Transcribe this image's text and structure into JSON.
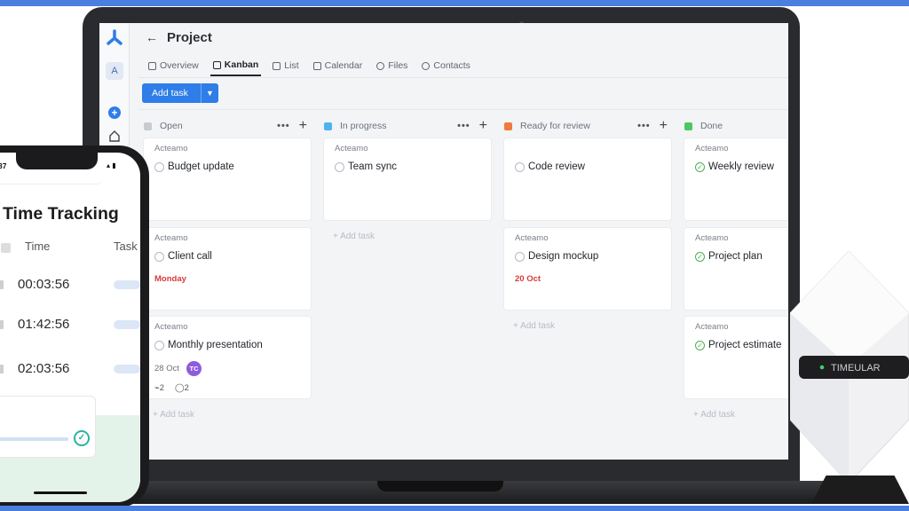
{
  "app": {
    "sidebar_avatar": "A",
    "page_title": "Project",
    "tabs": [
      {
        "label": "Overview",
        "active": false
      },
      {
        "label": "Kanban",
        "active": true
      },
      {
        "label": "List",
        "active": false
      },
      {
        "label": "Calendar",
        "active": false
      },
      {
        "label": "Files",
        "active": false
      },
      {
        "label": "Contacts",
        "active": false
      }
    ],
    "add_task_button": "Add task",
    "add_task_inline": "+ Add task",
    "columns": [
      {
        "title": "Open",
        "color": "#c8cbd0",
        "cards": [
          {
            "org": "Acteamo",
            "title": "Budget update"
          },
          {
            "org": "Acteamo",
            "title": "Client call",
            "due": "Monday"
          },
          {
            "org": "Acteamo",
            "title": "Monthly presentation",
            "date": "28 Oct",
            "assignee": "TC",
            "attachments": "2",
            "comments": "2"
          }
        ]
      },
      {
        "title": "In progress",
        "color": "#4fb3f0",
        "cards": [
          {
            "org": "Acteamo",
            "title": "Team sync"
          }
        ]
      },
      {
        "title": "Ready for review",
        "color": "#f07a3a",
        "cards": [
          {
            "title": "Code review"
          },
          {
            "org": "Acteamo",
            "title": "Design mockup",
            "due": "20 Oct"
          }
        ]
      },
      {
        "title": "Done",
        "color": "#4cc764",
        "cards": [
          {
            "org": "Acteamo",
            "title": "Weekly review"
          },
          {
            "org": "Acteamo",
            "title": "Project plan"
          },
          {
            "org": "Acteamo",
            "title": "Project estimate"
          }
        ]
      }
    ]
  },
  "phone": {
    "status_time": "37",
    "title": "Time Tracking",
    "col_time": "Time",
    "col_task": "Task",
    "rows": [
      "00:03:56",
      "01:42:56",
      "02:03:56"
    ]
  },
  "device": {
    "brand": "TIMEULAR"
  }
}
